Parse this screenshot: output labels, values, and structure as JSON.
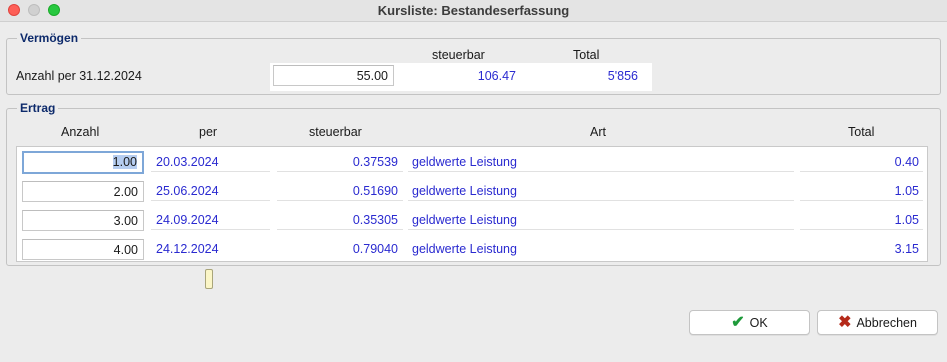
{
  "window": {
    "title": "Kursliste: Bestandeserfassung"
  },
  "vermoegen": {
    "group_title": "Vermögen",
    "col_steuerbar": "steuerbar",
    "col_total": "Total",
    "row_label": "Anzahl per 31.12.2024",
    "anzahl": "55.00",
    "steuerbar": "106.47",
    "total": "5'856"
  },
  "ertrag": {
    "group_title": "Ertrag",
    "headers": {
      "anzahl": "Anzahl",
      "per": "per",
      "steuerbar": "steuerbar",
      "art": "Art",
      "total": "Total"
    },
    "rows": [
      {
        "anzahl": "1.00",
        "per": "20.03.2024",
        "steuerbar": "0.37539",
        "art": "geldwerte Leistung",
        "total": "0.40"
      },
      {
        "anzahl": "2.00",
        "per": "25.06.2024",
        "steuerbar": "0.51690",
        "art": "geldwerte Leistung",
        "total": "1.05"
      },
      {
        "anzahl": "3.00",
        "per": "24.09.2024",
        "steuerbar": "0.35305",
        "art": "geldwerte Leistung",
        "total": "1.05"
      },
      {
        "anzahl": "4.00",
        "per": "24.12.2024",
        "steuerbar": "0.79040",
        "art": "geldwerte Leistung",
        "total": "3.15"
      }
    ]
  },
  "buttons": {
    "ok": "OK",
    "cancel": "Abbrechen"
  },
  "icons": {
    "ok": "checkmark-icon",
    "cancel": "cross-icon"
  },
  "colors": {
    "value_blue": "#2a2ad0",
    "group_title": "#0d2a6b",
    "ok_green": "#1e9a3a",
    "cancel_red": "#b52a1a"
  }
}
